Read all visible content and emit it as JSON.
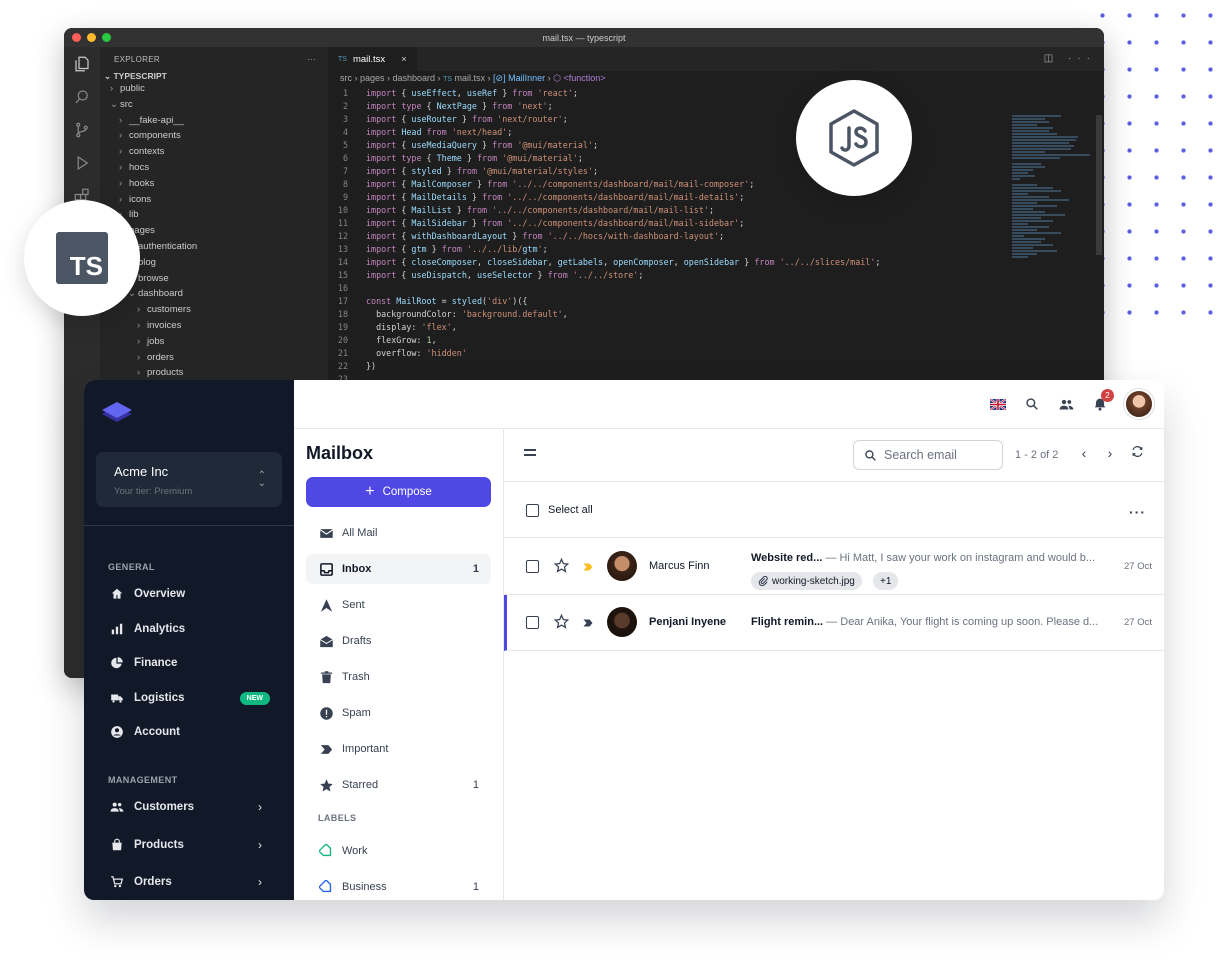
{
  "vscode": {
    "window_title": "mail.tsx — typescript",
    "explorer_label": "EXPLORER",
    "explorer_more": "···",
    "root": "TYPESCRIPT",
    "tree": [
      {
        "label": "public",
        "depth": 1,
        "chev": "›"
      },
      {
        "label": "src",
        "depth": 1,
        "chev": "⌄"
      },
      {
        "label": "__fake-api__",
        "depth": 2,
        "chev": "›"
      },
      {
        "label": "components",
        "depth": 2,
        "chev": "›"
      },
      {
        "label": "contexts",
        "depth": 2,
        "chev": "›"
      },
      {
        "label": "hocs",
        "depth": 2,
        "chev": "›"
      },
      {
        "label": "hooks",
        "depth": 2,
        "chev": "›"
      },
      {
        "label": "icons",
        "depth": 2,
        "chev": "›"
      },
      {
        "label": "lib",
        "depth": 2,
        "chev": "›"
      },
      {
        "label": "pages",
        "depth": 2,
        "chev": "⌄"
      },
      {
        "label": "authentication",
        "depth": 3,
        "chev": "›"
      },
      {
        "label": "blog",
        "depth": 3,
        "chev": "›"
      },
      {
        "label": "browse",
        "depth": 3,
        "chev": "›"
      },
      {
        "label": "dashboard",
        "depth": 3,
        "chev": "⌄"
      },
      {
        "label": "customers",
        "depth": 4,
        "chev": "›"
      },
      {
        "label": "invoices",
        "depth": 4,
        "chev": "›"
      },
      {
        "label": "jobs",
        "depth": 4,
        "chev": "›"
      },
      {
        "label": "orders",
        "depth": 4,
        "chev": "›"
      },
      {
        "label": "products",
        "depth": 4,
        "chev": "›"
      }
    ],
    "tab": {
      "lang": "TS",
      "file": "mail.tsx",
      "close": "×"
    },
    "tab_actions": "◫ ···",
    "breadcrumb": {
      "path": "src › pages › dashboard › ",
      "lang": "TS",
      "file": " mail.tsx › ",
      "symbol": "[⊘] MailInner",
      "sep": " › ",
      "fn": "⬡ <function>"
    },
    "code_lines": [
      "import { useEffect, useRef } from 'react';",
      "import type { NextPage } from 'next';",
      "import { useRouter } from 'next/router';",
      "import Head from 'next/head';",
      "import { useMediaQuery } from '@mui/material';",
      "import type { Theme } from '@mui/material';",
      "import { styled } from '@mui/material/styles';",
      "import { MailComposer } from '../../components/dashboard/mail/mail-composer';",
      "import { MailDetails } from '../../components/dashboard/mail/mail-details';",
      "import { MailList } from '../../components/dashboard/mail/mail-list';",
      "import { MailSidebar } from '../../components/dashboard/mail/mail-sidebar';",
      "import { withDashboardLayout } from '../../hocs/with-dashboard-layout';",
      "import { gtm } from '../../lib/gtm';",
      "import { closeComposer, closeSidebar, getLabels, openComposer, openSidebar } from '../../slices/mail';",
      "import { useDispatch, useSelector } from '../../store';",
      "",
      "const MailRoot = styled('div')({",
      "  backgroundColor: 'background.default',",
      "  display: 'flex',",
      "  flexGrow: 1,",
      "  overflow: 'hidden'",
      "})",
      ""
    ],
    "ts_badge": "TS"
  },
  "dashboard": {
    "org": {
      "name": "Acme Inc",
      "tier": "Your tier: Premium"
    },
    "general_title": "GENERAL",
    "general": [
      {
        "label": "Overview",
        "icon": "home-icon"
      },
      {
        "label": "Analytics",
        "icon": "chart-bar-icon"
      },
      {
        "label": "Finance",
        "icon": "pie-chart-icon"
      },
      {
        "label": "Logistics",
        "icon": "truck-icon",
        "badge": "NEW"
      },
      {
        "label": "Account",
        "icon": "user-circle-icon"
      }
    ],
    "management_title": "MANAGEMENT",
    "management": [
      {
        "label": "Customers",
        "icon": "users-icon"
      },
      {
        "label": "Products",
        "icon": "shopping-bag-icon"
      },
      {
        "label": "Orders",
        "icon": "shopping-cart-icon"
      }
    ],
    "notifications_count": "2",
    "mailbox_title": "Mailbox",
    "compose_label": "Compose",
    "mail_nav": [
      {
        "label": "All Mail",
        "count": ""
      },
      {
        "label": "Inbox",
        "count": "1"
      },
      {
        "label": "Sent",
        "count": ""
      },
      {
        "label": "Drafts",
        "count": ""
      },
      {
        "label": "Trash",
        "count": ""
      },
      {
        "label": "Spam",
        "count": ""
      },
      {
        "label": "Important",
        "count": ""
      },
      {
        "label": "Starred",
        "count": "1"
      }
    ],
    "labels_title": "LABELS",
    "labels": [
      {
        "label": "Work",
        "count": "",
        "color": "#10b981"
      },
      {
        "label": "Business",
        "count": "1",
        "color": "#2563eb"
      }
    ],
    "search_placeholder": "Search email",
    "pager": "1 - 2 of 2",
    "select_all": "Select all",
    "emails": [
      {
        "sender": "Marcus Finn",
        "subject": "Website red...",
        "preview": "— Hi Matt, I saw your work on instagram and would b...",
        "date": "27 Oct",
        "attachment": "working-sketch.jpg",
        "extra": "+1",
        "important_color": "#fbbf24"
      },
      {
        "sender": "Penjani Inyene",
        "subject": "Flight remin...",
        "preview": "— Dear Anika, Your flight is coming up soon. Please d...",
        "date": "27 Oct",
        "important_color": "#374151"
      }
    ],
    "accent": "#5048e5"
  }
}
